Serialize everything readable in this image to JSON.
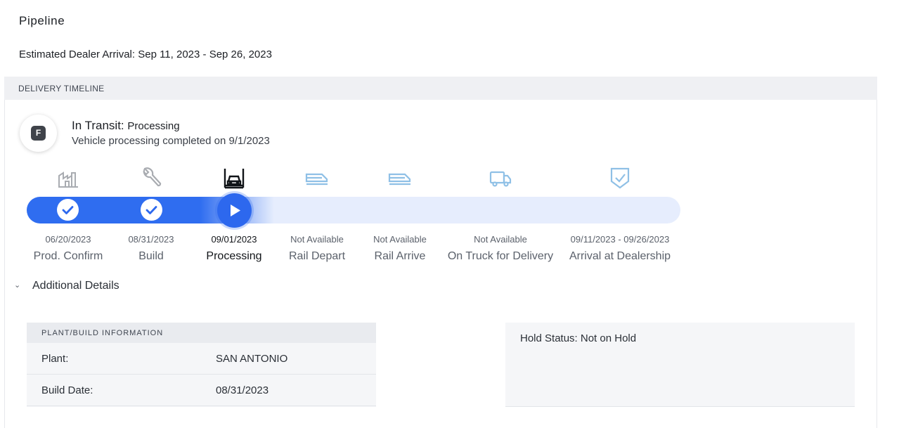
{
  "page": {
    "title": "Pipeline",
    "estimated_arrival": "Estimated Dealer Arrival: Sep 11, 2023 - Sep 26, 2023"
  },
  "timeline": {
    "header": "DELIVERY TIMELINE",
    "badge_letter": "F",
    "status_label": "In Transit:",
    "status_state": "Processing",
    "status_detail": "Vehicle processing completed on 9/1/2023",
    "progress_completed_stages": 3,
    "stages": [
      {
        "date": "06/20/2023",
        "label": "Prod. Confirm",
        "icon": "factory-icon",
        "state": "complete"
      },
      {
        "date": "08/31/2023",
        "label": "Build",
        "icon": "wrench-icon",
        "state": "complete"
      },
      {
        "date": "09/01/2023",
        "label": "Processing",
        "icon": "car-lift-icon",
        "state": "current"
      },
      {
        "date": "Not Available",
        "label": "Rail Depart",
        "icon": "train-icon",
        "state": "pending"
      },
      {
        "date": "Not Available",
        "label": "Rail Arrive",
        "icon": "train-icon",
        "state": "pending"
      },
      {
        "date": "Not Available",
        "label": "On Truck for Delivery",
        "icon": "truck-icon",
        "state": "pending"
      },
      {
        "date": "09/11/2023 - 09/26/2023",
        "label": "Arrival at Dealership",
        "icon": "shield-check-icon",
        "state": "pending"
      }
    ]
  },
  "details": {
    "toggle_label": "Additional Details",
    "plant_header": "PLANT/BUILD INFORMATION",
    "rows": [
      {
        "key": "Plant:",
        "value": "SAN ANTONIO"
      },
      {
        "key": "Build Date:",
        "value": "08/31/2023"
      }
    ],
    "hold_status": "Hold Status: Not on Hold"
  },
  "colors": {
    "accent": "#2d68ee",
    "track": "#e6edfd",
    "pending_icon": "#8fc0e6",
    "done_icon": "#a9acb1"
  }
}
